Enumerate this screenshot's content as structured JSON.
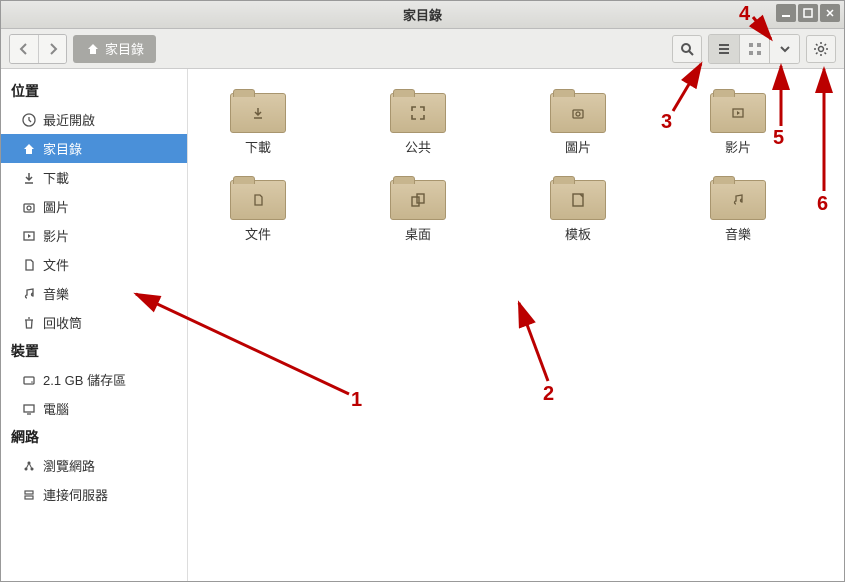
{
  "window": {
    "title": "家目錄"
  },
  "toolbar": {
    "path_label": "家目錄"
  },
  "sidebar": {
    "sections": [
      {
        "header": "位置",
        "items": [
          {
            "icon": "clock",
            "label": "最近開啟",
            "selected": false
          },
          {
            "icon": "home",
            "label": "家目錄",
            "selected": true
          },
          {
            "icon": "download",
            "label": "下載",
            "selected": false
          },
          {
            "icon": "camera",
            "label": "圖片",
            "selected": false
          },
          {
            "icon": "video",
            "label": "影片",
            "selected": false
          },
          {
            "icon": "document",
            "label": "文件",
            "selected": false
          },
          {
            "icon": "music",
            "label": "音樂",
            "selected": false
          },
          {
            "icon": "trash",
            "label": "回收筒",
            "selected": false
          }
        ]
      },
      {
        "header": "裝置",
        "items": [
          {
            "icon": "disk",
            "label": "2.1 GB 儲存區",
            "selected": false
          },
          {
            "icon": "computer",
            "label": "電腦",
            "selected": false
          }
        ]
      },
      {
        "header": "網路",
        "items": [
          {
            "icon": "network",
            "label": "瀏覽網路",
            "selected": false
          },
          {
            "icon": "server",
            "label": "連接伺服器",
            "selected": false
          }
        ]
      }
    ]
  },
  "folders": [
    {
      "label": "下載",
      "glyph": "download"
    },
    {
      "label": "公共",
      "glyph": "expand"
    },
    {
      "label": "圖片",
      "glyph": "camera"
    },
    {
      "label": "影片",
      "glyph": "video"
    },
    {
      "label": "文件",
      "glyph": "document"
    },
    {
      "label": "桌面",
      "glyph": "desktop"
    },
    {
      "label": "模板",
      "glyph": "template"
    },
    {
      "label": "音樂",
      "glyph": "music"
    }
  ],
  "annotations": {
    "a1": "1",
    "a2": "2",
    "a3": "3",
    "a4": "4",
    "a5": "5",
    "a6": "6"
  }
}
